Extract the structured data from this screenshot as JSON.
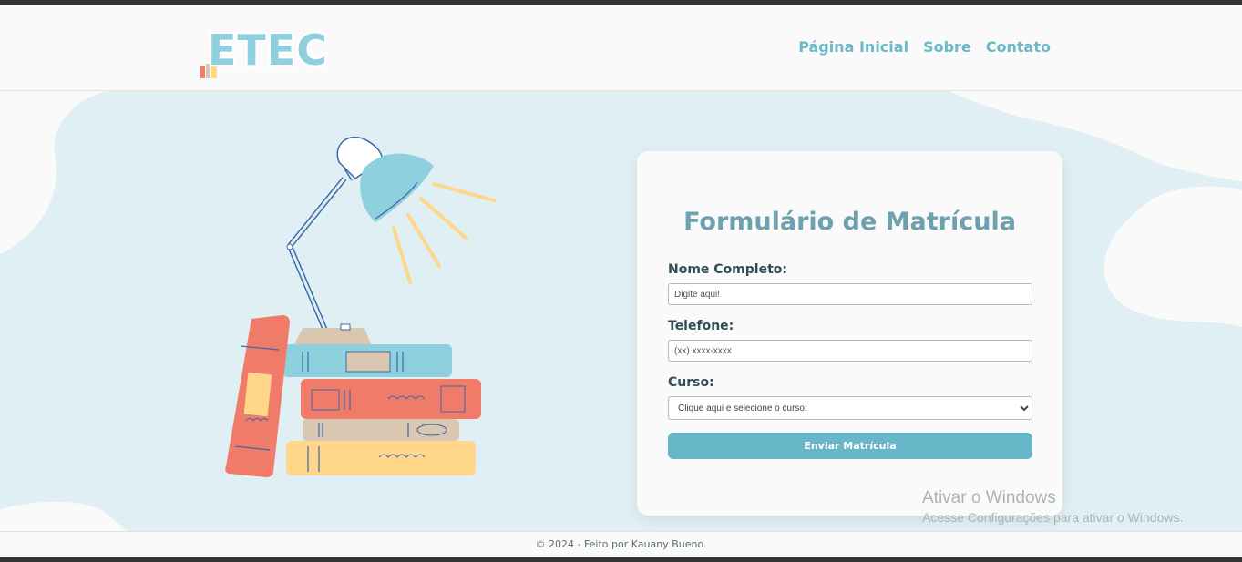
{
  "header": {
    "logo_text": "ETEC",
    "nav": [
      "Página Inicial",
      "Sobre",
      "Contato"
    ]
  },
  "form": {
    "title": "Formulário de Matrícula",
    "name_label": "Nome Completo:",
    "name_placeholder": "Digite aqui!",
    "phone_label": "Telefone:",
    "phone_placeholder": "(xx) xxxx-xxxx",
    "course_label": "Curso:",
    "course_selected": "Clique aqui e selecione o curso:",
    "submit_label": "Enviar Matrícula"
  },
  "watermark": {
    "line1": "Ativar o Windows",
    "line2": "Acesse Configurações para ativar o Windows."
  },
  "footer": {
    "text": "© 2024 - Feito por Kauany Bueno."
  },
  "colors": {
    "accent": "#67b7c8",
    "title": "#6ca1ad",
    "hero_bg": "#dfeff4",
    "lamp": "#8fd0de",
    "book_red": "#ef7b68",
    "book_beige": "#d9c7b1",
    "book_yellow": "#ffd68a"
  }
}
